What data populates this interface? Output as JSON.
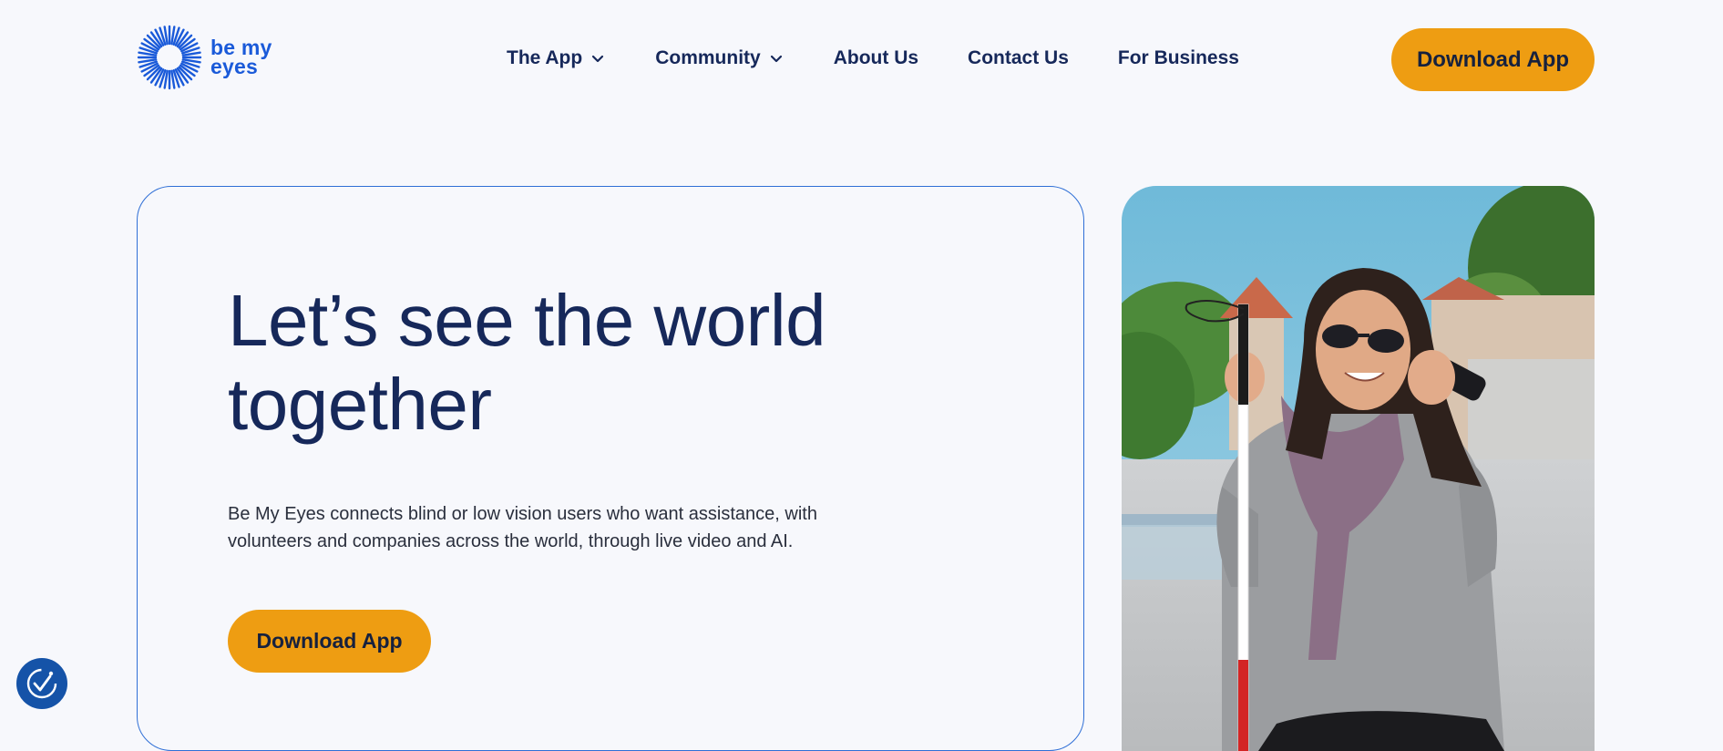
{
  "logo": {
    "line1": "be my",
    "line2": "eyes",
    "icon": "sunburst-eye-icon"
  },
  "nav": {
    "items": [
      {
        "label": "The App",
        "has_dropdown": true
      },
      {
        "label": "Community",
        "has_dropdown": true
      },
      {
        "label": "About Us",
        "has_dropdown": false
      },
      {
        "label": "Contact Us",
        "has_dropdown": false
      },
      {
        "label": "For Business",
        "has_dropdown": false
      }
    ]
  },
  "header": {
    "download_label": "Download App"
  },
  "hero": {
    "title_line1": "Let’s see the world",
    "title_line2": "together",
    "subtitle_line1": "Be My Eyes connects blind or low vision users who want assistance, with",
    "subtitle_line2": "volunteers and companies across the world, through live video and AI.",
    "download_label": "Download App",
    "image_icon": "woman-with-white-cane-photo"
  },
  "accessibility_widget": {
    "icon": "accessibility-checkmark-icon"
  },
  "colors": {
    "background": "#f7f8fc",
    "brand_blue": "#1a5ad9",
    "navy_text": "#16285a",
    "accent_orange": "#ee9d12",
    "card_border": "#2f6fd6"
  }
}
